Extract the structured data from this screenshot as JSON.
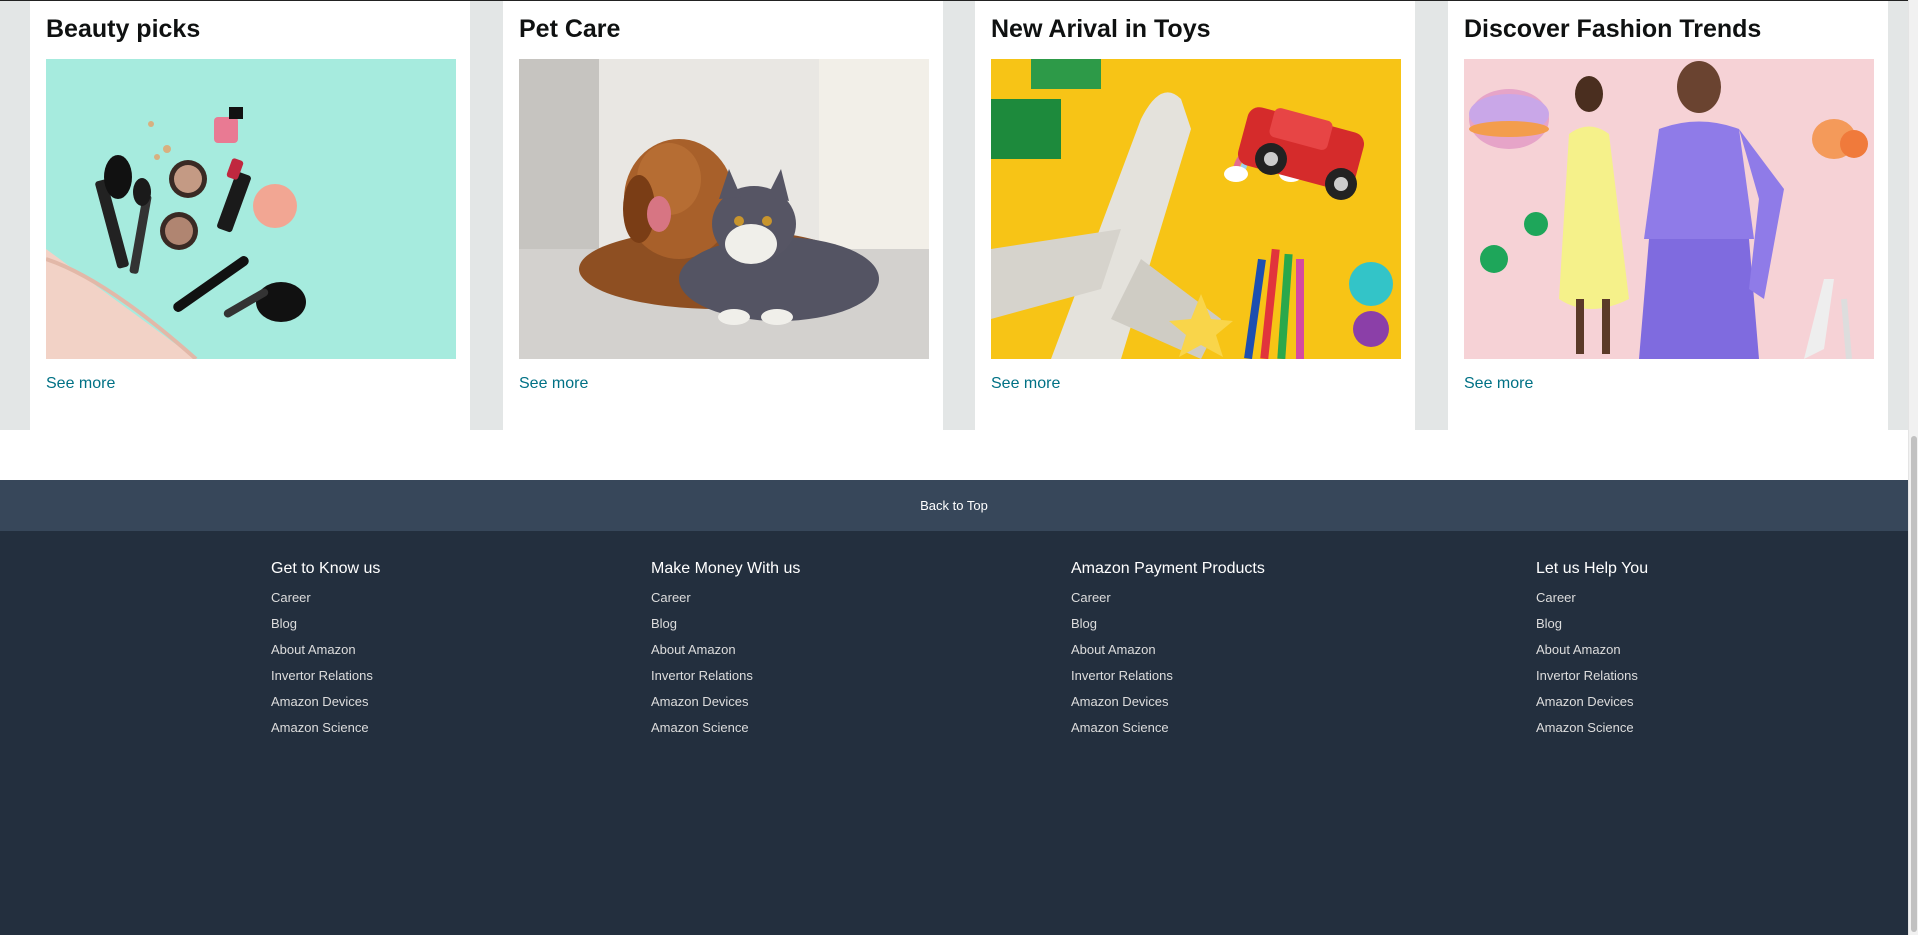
{
  "cards": [
    {
      "title": "Beauty picks",
      "link": "See more",
      "image": "cosmetics-bag-image"
    },
    {
      "title": "Pet Care",
      "link": "See more",
      "image": "dog-and-cat-image"
    },
    {
      "title": "New Arival in Toys",
      "link": "See more",
      "image": "toys-image"
    },
    {
      "title": "Discover Fashion Trends",
      "link": "See more",
      "image": "fashion-models-image"
    }
  ],
  "back_to_top": "Back to Top",
  "footer": {
    "columns": [
      {
        "heading": "Get to Know us",
        "links": [
          "Career",
          "Blog",
          "About Amazon",
          "Invertor Relations",
          "Amazon Devices",
          "Amazon Science"
        ]
      },
      {
        "heading": "Make Money With us",
        "links": [
          "Career",
          "Blog",
          "About Amazon",
          "Invertor Relations",
          "Amazon Devices",
          "Amazon Science"
        ]
      },
      {
        "heading": "Amazon Payment Products",
        "links": [
          "Career",
          "Blog",
          "About Amazon",
          "Invertor Relations",
          "Amazon Devices",
          "Amazon Science"
        ]
      },
      {
        "heading": "Let us Help You",
        "links": [
          "Career",
          "Blog",
          "About Amazon",
          "Invertor Relations",
          "Amazon Devices",
          "Amazon Science"
        ]
      }
    ]
  },
  "colors": {
    "link": "#007185",
    "back_to_top_bg": "#37475a",
    "footer_bg": "#232f3e",
    "band_bg": "#e3e6e6"
  }
}
